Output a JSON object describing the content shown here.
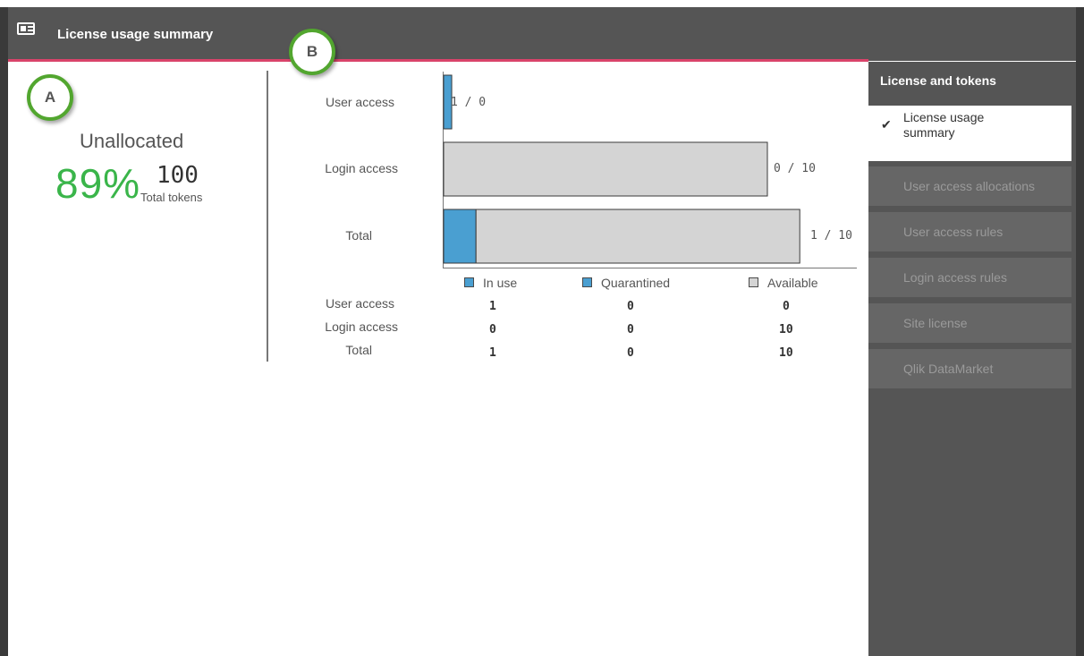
{
  "header": {
    "title": "License usage summary",
    "icon": "license-card-icon"
  },
  "markers": {
    "a": "A",
    "b": "B"
  },
  "summary": {
    "label": "Unallocated",
    "percent": "89%",
    "total": "100",
    "total_label": "Total tokens"
  },
  "chart_data": {
    "type": "bar",
    "orientation": "horizontal",
    "stacked": true,
    "categories": [
      "User access",
      "Login access",
      "Total"
    ],
    "series": [
      {
        "name": "In use",
        "values": [
          1,
          0,
          1
        ],
        "color": "#4a9fd1"
      },
      {
        "name": "Quarantined",
        "values": [
          0,
          0,
          0
        ],
        "color": "#4a9fd1"
      },
      {
        "name": "Available",
        "values": [
          0,
          10,
          10
        ],
        "color": "#d4d4d4"
      }
    ],
    "bar_labels": [
      "1 / 0",
      "0 / 10",
      "1 / 10"
    ],
    "xlim": [
      0,
      11.5
    ],
    "legend": "bottom"
  },
  "table": {
    "rows": [
      {
        "label": "User access",
        "in_use": "1",
        "quarantined": "0",
        "available": "0"
      },
      {
        "label": "Login access",
        "in_use": "0",
        "quarantined": "0",
        "available": "10"
      },
      {
        "label": "Total",
        "in_use": "1",
        "quarantined": "0",
        "available": "10"
      }
    ]
  },
  "sidebar": {
    "title": "License and tokens",
    "items": [
      {
        "label": "License usage summary",
        "active": true
      },
      {
        "label": "User access allocations",
        "active": false
      },
      {
        "label": "User access rules",
        "active": false
      },
      {
        "label": "Login access rules",
        "active": false
      },
      {
        "label": "Site license",
        "active": false
      },
      {
        "label": "Qlik DataMarket",
        "active": false
      }
    ]
  },
  "colors": {
    "accent": "#d9436a",
    "percent": "#3ab54a",
    "in_use": "#4a9fd1",
    "available": "#d4d4d4"
  }
}
